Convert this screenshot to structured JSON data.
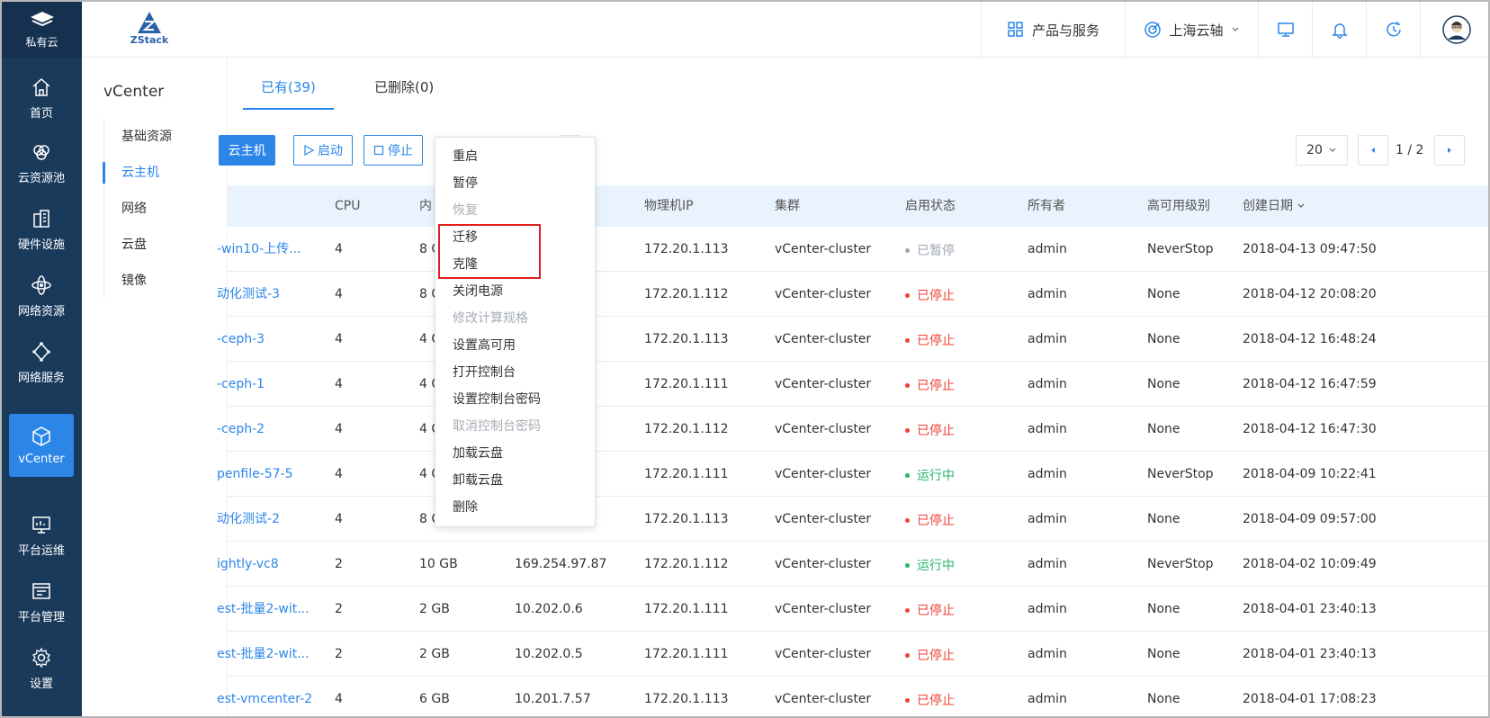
{
  "nav": {
    "brand": "私有云",
    "items": [
      {
        "label": "首页",
        "icon": "home-icon"
      },
      {
        "label": "云资源池",
        "icon": "cloud-pool-icon"
      },
      {
        "label": "硬件设施",
        "icon": "hardware-icon"
      },
      {
        "label": "网络资源",
        "icon": "network-resource-icon"
      },
      {
        "label": "网络服务",
        "icon": "network-service-icon"
      },
      {
        "label": "vCenter",
        "icon": "cube-icon",
        "active": true
      },
      {
        "label": "平台运维",
        "icon": "ops-monitor-icon"
      },
      {
        "label": "平台管理",
        "icon": "platform-manage-icon"
      },
      {
        "label": "设置",
        "icon": "gear-icon"
      }
    ]
  },
  "topbar": {
    "logo": "ZStack",
    "products": "产品与服务",
    "region": "上海云轴"
  },
  "subnav": {
    "title": "vCenter",
    "items": [
      "基础资源",
      "云主机",
      "网络",
      "云盘",
      "镜像"
    ],
    "active_index": 1
  },
  "tabs": [
    {
      "label": "已有(39)",
      "active": true
    },
    {
      "label": "已删除(0)",
      "active": false
    }
  ],
  "toolbar": {
    "create": "云主机",
    "start": "启动",
    "stop": "停止",
    "page_size": "20",
    "page_indicator": "1 / 2"
  },
  "table": {
    "headers": [
      "CPU",
      "内",
      "物理机IP",
      "集群",
      "启用状态",
      "所有者",
      "高可用级别",
      "创建日期"
    ],
    "rows": [
      {
        "name": "-win10-上传...",
        "cpu": "4",
        "mem": "8 C",
        "ip": "",
        "host": "172.20.1.113",
        "cluster": "vCenter-cluster",
        "status": "已暂停",
        "owner": "admin",
        "ha": "NeverStop",
        "date": "2018-04-13 09:47:50"
      },
      {
        "name": "动化测试-3",
        "cpu": "4",
        "mem": "8 C",
        "ip": "",
        "host": "172.20.1.112",
        "cluster": "vCenter-cluster",
        "status": "已停止",
        "owner": "admin",
        "ha": "None",
        "date": "2018-04-12 20:08:20"
      },
      {
        "name": "-ceph-3",
        "cpu": "4",
        "mem": "4 C",
        "ip": "",
        "host": "172.20.1.113",
        "cluster": "vCenter-cluster",
        "status": "已停止",
        "owner": "admin",
        "ha": "None",
        "date": "2018-04-12 16:48:24"
      },
      {
        "name": "-ceph-1",
        "cpu": "4",
        "mem": "4 C",
        "ip": "",
        "host": "172.20.1.111",
        "cluster": "vCenter-cluster",
        "status": "已停止",
        "owner": "admin",
        "ha": "None",
        "date": "2018-04-12 16:47:59"
      },
      {
        "name": "-ceph-2",
        "cpu": "4",
        "mem": "4 C",
        "ip": "",
        "host": "172.20.1.112",
        "cluster": "vCenter-cluster",
        "status": "已停止",
        "owner": "admin",
        "ha": "None",
        "date": "2018-04-12 16:47:30"
      },
      {
        "name": "penfile-57-5",
        "cpu": "4",
        "mem": "4 C",
        "ip": "",
        "host": "172.20.1.111",
        "cluster": "vCenter-cluster",
        "status": "运行中",
        "owner": "admin",
        "ha": "NeverStop",
        "date": "2018-04-09 10:22:41"
      },
      {
        "name": "动化测试-2",
        "cpu": "4",
        "mem": "8 C",
        "ip": "7",
        "host": "172.20.1.113",
        "cluster": "vCenter-cluster",
        "status": "已停止",
        "owner": "admin",
        "ha": "None",
        "date": "2018-04-09 09:57:00"
      },
      {
        "name": "ightly-vc8",
        "cpu": "2",
        "mem": "10 GB",
        "ip": "169.254.97.87",
        "host": "172.20.1.112",
        "cluster": "vCenter-cluster",
        "status": "运行中",
        "owner": "admin",
        "ha": "NeverStop",
        "date": "2018-04-02 10:09:49"
      },
      {
        "name": "est-批量2-wit...",
        "cpu": "2",
        "mem": "2 GB",
        "ip": "10.202.0.6",
        "host": "172.20.1.111",
        "cluster": "vCenter-cluster",
        "status": "已停止",
        "owner": "admin",
        "ha": "None",
        "date": "2018-04-01 23:40:13"
      },
      {
        "name": "est-批量2-wit...",
        "cpu": "2",
        "mem": "2 GB",
        "ip": "10.202.0.5",
        "host": "172.20.1.111",
        "cluster": "vCenter-cluster",
        "status": "已停止",
        "owner": "admin",
        "ha": "None",
        "date": "2018-04-01 23:40:13"
      },
      {
        "name": "est-vmcenter-2",
        "cpu": "4",
        "mem": "6 GB",
        "ip": "10.201.7.57",
        "host": "172.20.1.113",
        "cluster": "vCenter-cluster",
        "status": "已停止",
        "owner": "admin",
        "ha": "None",
        "date": "2018-04-01 17:08:23"
      }
    ]
  },
  "status_colors": {
    "已暂停": "#9ea7b3",
    "已停止": "#f04134",
    "运行中": "#27b56a"
  },
  "menu": {
    "items": [
      {
        "label": "重启",
        "disabled": false
      },
      {
        "label": "暂停",
        "disabled": false
      },
      {
        "label": "恢复",
        "disabled": true
      },
      {
        "label": "迁移",
        "disabled": false
      },
      {
        "label": "克隆",
        "disabled": false
      },
      {
        "label": "关闭电源",
        "disabled": false
      },
      {
        "label": "修改计算规格",
        "disabled": true
      },
      {
        "label": "设置高可用",
        "disabled": false
      },
      {
        "label": "打开控制台",
        "disabled": false
      },
      {
        "label": "设置控制台密码",
        "disabled": false
      },
      {
        "label": "取消控制台密码",
        "disabled": true
      },
      {
        "label": "加载云盘",
        "disabled": false
      },
      {
        "label": "卸载云盘",
        "disabled": false
      },
      {
        "label": "删除",
        "disabled": false
      }
    ]
  },
  "colors": {
    "accent": "#2b86e8",
    "nav_bg": "#1a3a5c",
    "highlight": "#e0201f"
  }
}
